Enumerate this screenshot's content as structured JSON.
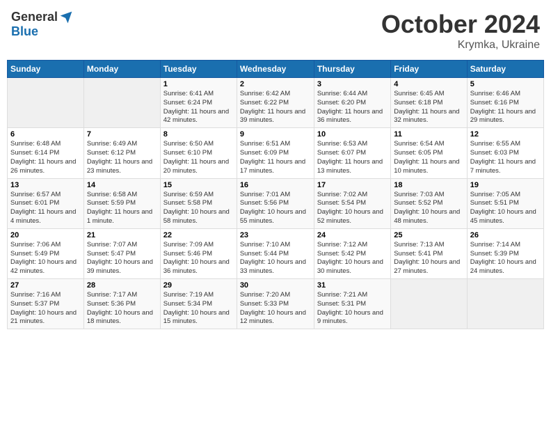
{
  "header": {
    "logo_general": "General",
    "logo_blue": "Blue",
    "month": "October 2024",
    "location": "Krymka, Ukraine"
  },
  "days_of_week": [
    "Sunday",
    "Monday",
    "Tuesday",
    "Wednesday",
    "Thursday",
    "Friday",
    "Saturday"
  ],
  "weeks": [
    [
      {
        "num": "",
        "detail": ""
      },
      {
        "num": "",
        "detail": ""
      },
      {
        "num": "1",
        "detail": "Sunrise: 6:41 AM\nSunset: 6:24 PM\nDaylight: 11 hours and 42 minutes."
      },
      {
        "num": "2",
        "detail": "Sunrise: 6:42 AM\nSunset: 6:22 PM\nDaylight: 11 hours and 39 minutes."
      },
      {
        "num": "3",
        "detail": "Sunrise: 6:44 AM\nSunset: 6:20 PM\nDaylight: 11 hours and 36 minutes."
      },
      {
        "num": "4",
        "detail": "Sunrise: 6:45 AM\nSunset: 6:18 PM\nDaylight: 11 hours and 32 minutes."
      },
      {
        "num": "5",
        "detail": "Sunrise: 6:46 AM\nSunset: 6:16 PM\nDaylight: 11 hours and 29 minutes."
      }
    ],
    [
      {
        "num": "6",
        "detail": "Sunrise: 6:48 AM\nSunset: 6:14 PM\nDaylight: 11 hours and 26 minutes."
      },
      {
        "num": "7",
        "detail": "Sunrise: 6:49 AM\nSunset: 6:12 PM\nDaylight: 11 hours and 23 minutes."
      },
      {
        "num": "8",
        "detail": "Sunrise: 6:50 AM\nSunset: 6:10 PM\nDaylight: 11 hours and 20 minutes."
      },
      {
        "num": "9",
        "detail": "Sunrise: 6:51 AM\nSunset: 6:09 PM\nDaylight: 11 hours and 17 minutes."
      },
      {
        "num": "10",
        "detail": "Sunrise: 6:53 AM\nSunset: 6:07 PM\nDaylight: 11 hours and 13 minutes."
      },
      {
        "num": "11",
        "detail": "Sunrise: 6:54 AM\nSunset: 6:05 PM\nDaylight: 11 hours and 10 minutes."
      },
      {
        "num": "12",
        "detail": "Sunrise: 6:55 AM\nSunset: 6:03 PM\nDaylight: 11 hours and 7 minutes."
      }
    ],
    [
      {
        "num": "13",
        "detail": "Sunrise: 6:57 AM\nSunset: 6:01 PM\nDaylight: 11 hours and 4 minutes."
      },
      {
        "num": "14",
        "detail": "Sunrise: 6:58 AM\nSunset: 5:59 PM\nDaylight: 11 hours and 1 minute."
      },
      {
        "num": "15",
        "detail": "Sunrise: 6:59 AM\nSunset: 5:58 PM\nDaylight: 10 hours and 58 minutes."
      },
      {
        "num": "16",
        "detail": "Sunrise: 7:01 AM\nSunset: 5:56 PM\nDaylight: 10 hours and 55 minutes."
      },
      {
        "num": "17",
        "detail": "Sunrise: 7:02 AM\nSunset: 5:54 PM\nDaylight: 10 hours and 52 minutes."
      },
      {
        "num": "18",
        "detail": "Sunrise: 7:03 AM\nSunset: 5:52 PM\nDaylight: 10 hours and 48 minutes."
      },
      {
        "num": "19",
        "detail": "Sunrise: 7:05 AM\nSunset: 5:51 PM\nDaylight: 10 hours and 45 minutes."
      }
    ],
    [
      {
        "num": "20",
        "detail": "Sunrise: 7:06 AM\nSunset: 5:49 PM\nDaylight: 10 hours and 42 minutes."
      },
      {
        "num": "21",
        "detail": "Sunrise: 7:07 AM\nSunset: 5:47 PM\nDaylight: 10 hours and 39 minutes."
      },
      {
        "num": "22",
        "detail": "Sunrise: 7:09 AM\nSunset: 5:46 PM\nDaylight: 10 hours and 36 minutes."
      },
      {
        "num": "23",
        "detail": "Sunrise: 7:10 AM\nSunset: 5:44 PM\nDaylight: 10 hours and 33 minutes."
      },
      {
        "num": "24",
        "detail": "Sunrise: 7:12 AM\nSunset: 5:42 PM\nDaylight: 10 hours and 30 minutes."
      },
      {
        "num": "25",
        "detail": "Sunrise: 7:13 AM\nSunset: 5:41 PM\nDaylight: 10 hours and 27 minutes."
      },
      {
        "num": "26",
        "detail": "Sunrise: 7:14 AM\nSunset: 5:39 PM\nDaylight: 10 hours and 24 minutes."
      }
    ],
    [
      {
        "num": "27",
        "detail": "Sunrise: 7:16 AM\nSunset: 5:37 PM\nDaylight: 10 hours and 21 minutes."
      },
      {
        "num": "28",
        "detail": "Sunrise: 7:17 AM\nSunset: 5:36 PM\nDaylight: 10 hours and 18 minutes."
      },
      {
        "num": "29",
        "detail": "Sunrise: 7:19 AM\nSunset: 5:34 PM\nDaylight: 10 hours and 15 minutes."
      },
      {
        "num": "30",
        "detail": "Sunrise: 7:20 AM\nSunset: 5:33 PM\nDaylight: 10 hours and 12 minutes."
      },
      {
        "num": "31",
        "detail": "Sunrise: 7:21 AM\nSunset: 5:31 PM\nDaylight: 10 hours and 9 minutes."
      },
      {
        "num": "",
        "detail": ""
      },
      {
        "num": "",
        "detail": ""
      }
    ]
  ]
}
